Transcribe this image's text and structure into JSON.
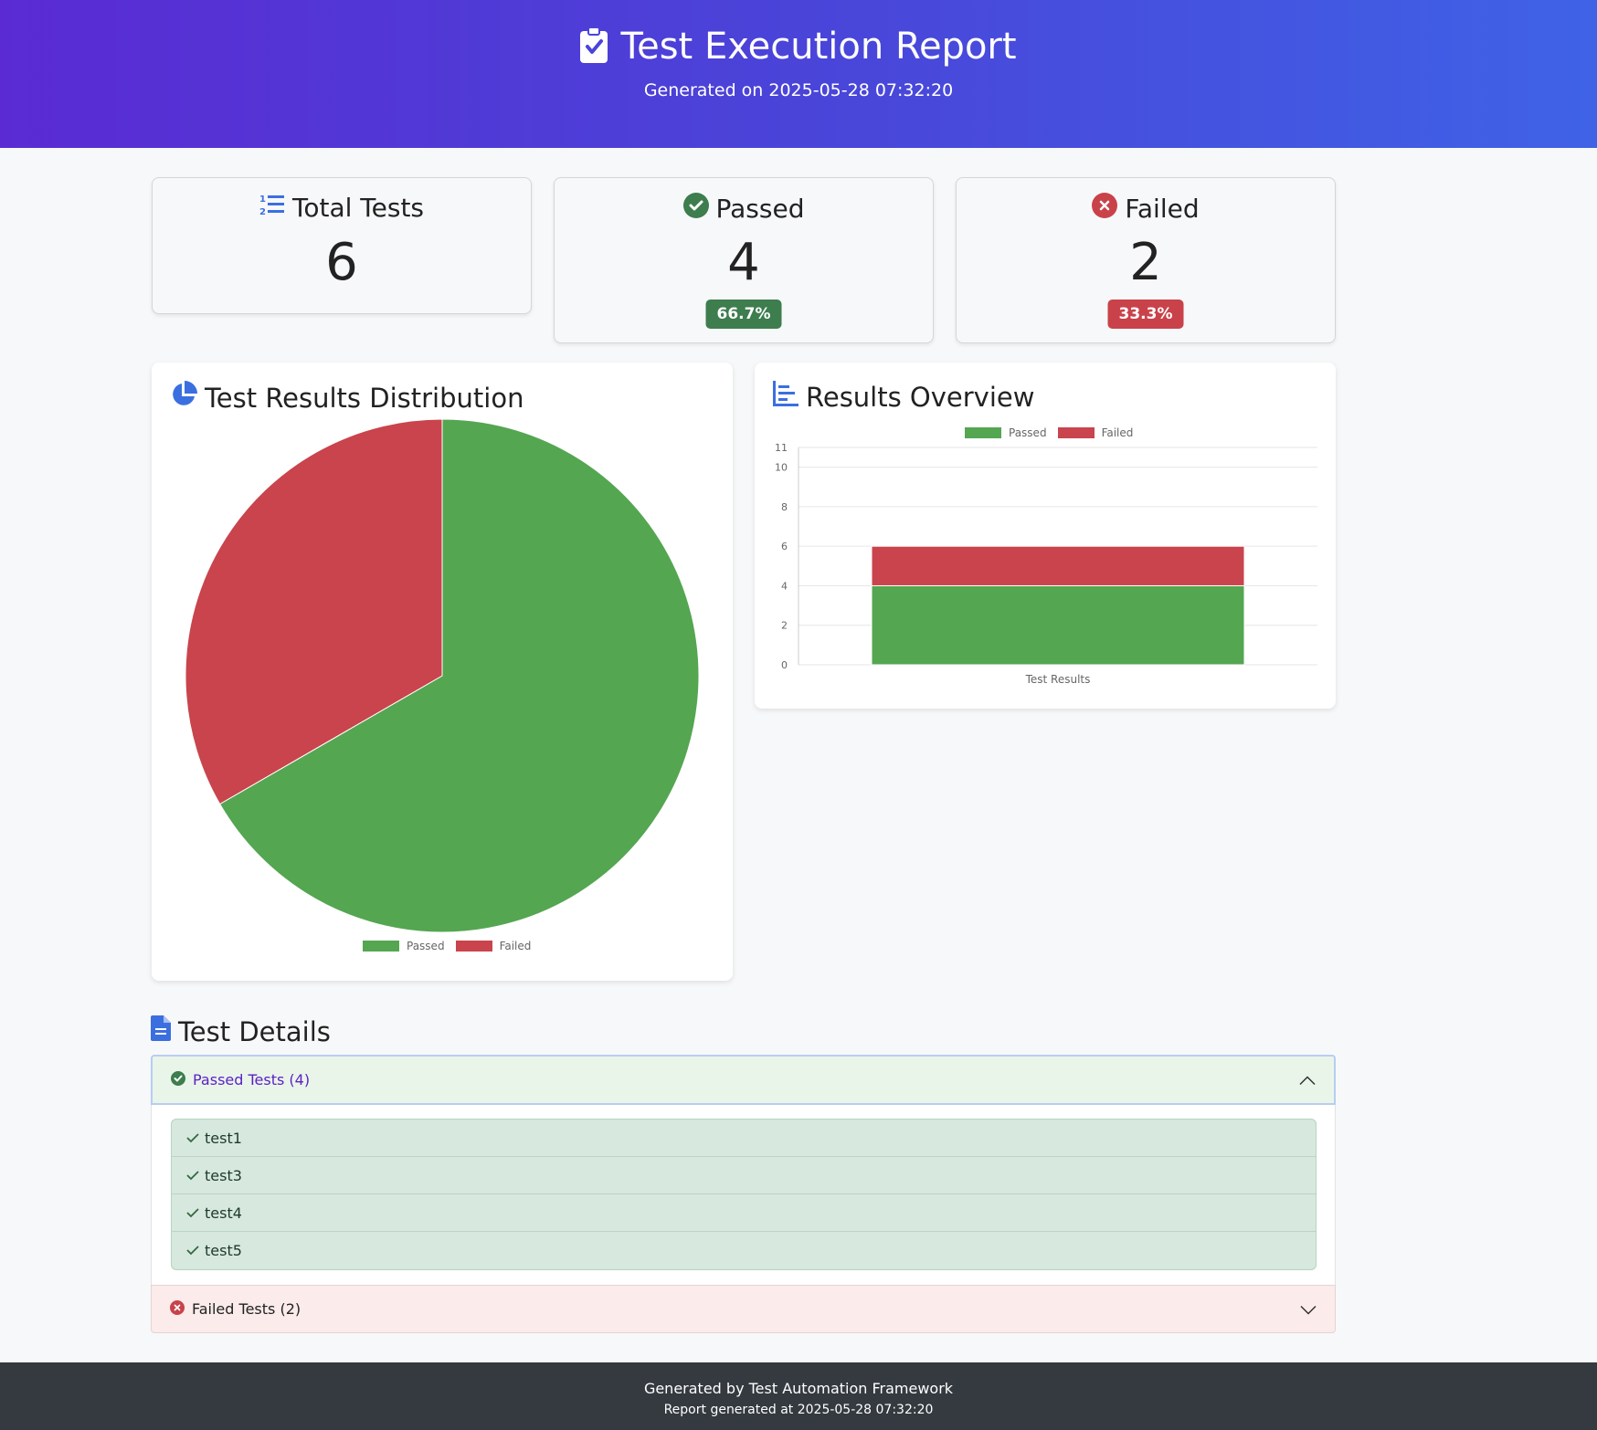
{
  "header": {
    "title": "Test Execution Report",
    "generated": "Generated on 2025-05-28 07:32:20"
  },
  "summary": {
    "total": {
      "label": "Total Tests",
      "value": "6",
      "icon": "list-ol-icon"
    },
    "passed": {
      "label": "Passed",
      "value": "4",
      "percent": "66.7%",
      "icon": "check-circle-icon",
      "color": "#3d7d4e"
    },
    "failed": {
      "label": "Failed",
      "value": "2",
      "percent": "33.3%",
      "icon": "x-circle-icon",
      "color": "#c9424a"
    }
  },
  "charts": {
    "pie_title": "Test Results Distribution",
    "bar_title": "Results Overview"
  },
  "chart_data": [
    {
      "type": "pie",
      "labels": [
        "Passed",
        "Failed"
      ],
      "values": [
        4,
        2
      ],
      "colors": [
        "#54a651",
        "#c9444c"
      ],
      "legend": "bottom"
    },
    {
      "type": "bar",
      "stacked": true,
      "categories": [
        "Test Results"
      ],
      "series": [
        {
          "name": "Passed",
          "values": [
            4
          ],
          "color": "#54a651"
        },
        {
          "name": "Failed",
          "values": [
            2
          ],
          "color": "#c9444c"
        }
      ],
      "yticks": [
        "0",
        "2",
        "4",
        "6",
        "8",
        "10",
        "11"
      ],
      "ylim": [
        0,
        11
      ],
      "grid": true,
      "legend": "top"
    }
  ],
  "details": {
    "title": "Test Details",
    "passed_header": "Passed Tests (4)",
    "passed_tests": [
      "test1",
      "test3",
      "test4",
      "test5"
    ],
    "failed_header": "Failed Tests (2)"
  },
  "footer": {
    "line1": "Generated by Test Automation Framework",
    "line2": "Report generated at 2025-05-28 07:32:20"
  }
}
